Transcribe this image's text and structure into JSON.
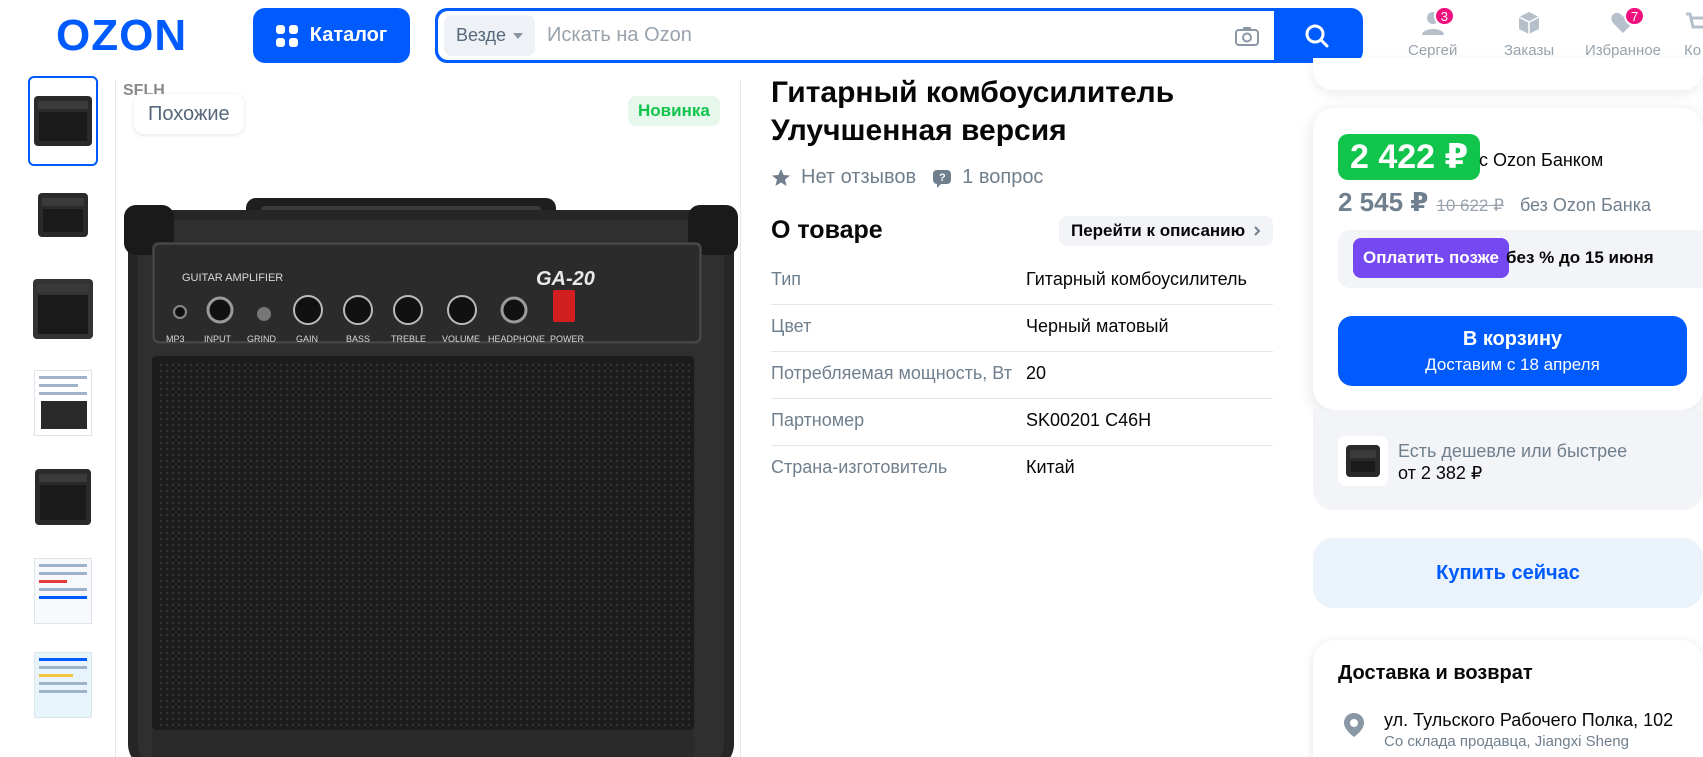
{
  "header": {
    "logo_text": "OZON",
    "catalog_label": "Каталог",
    "search": {
      "scope": "Везде",
      "placeholder": "Искать на Ozon"
    },
    "nav": [
      {
        "label": "Сергей",
        "icon": "user-icon",
        "badge": "3"
      },
      {
        "label": "Заказы",
        "icon": "box-icon",
        "badge": ""
      },
      {
        "label": "Избранное",
        "icon": "heart-icon",
        "badge": "7"
      },
      {
        "label": "Ко",
        "icon": "cart-icon",
        "badge": ""
      }
    ]
  },
  "gallery": {
    "similar_label": "Похожие",
    "new_badge": "Новинка",
    "brand_fragment": "SFLH",
    "amp_texts": {
      "guitar_amplifier": "GUITAR AMPLIFIER",
      "model": "GA-20",
      "controls": [
        "MP3",
        "INPUT",
        "GRIND",
        "GAIN",
        "BASS",
        "TREBLE",
        "VOLUME",
        "HEADPHONE",
        "POWER"
      ]
    },
    "thumbnails": [
      "amp-front",
      "amp-front-2",
      "amp-side",
      "amp-doc",
      "amp-angle",
      "doc-1",
      "doc-2"
    ]
  },
  "product": {
    "title": "Гитарный комбоусилитель Улучшенная версия",
    "reviews": "Нет отзывов",
    "questions": "1 вопрос",
    "about_title": "О товаре",
    "to_description": "Перейти к описанию",
    "specs": [
      {
        "key": "Тип",
        "value": "Гитарный комбоусилитель"
      },
      {
        "key": "Цвет",
        "value": "Черный матовый"
      },
      {
        "key": "Потребляемая мощность, Вт",
        "value": "20"
      },
      {
        "key": "Партномер",
        "value": "SK00201 C46H"
      },
      {
        "key": "Страна-изготовитель",
        "value": "Китай"
      }
    ]
  },
  "pricing": {
    "price_bank": "2 422 ₽",
    "price_bank_label": "с Ozon Банком",
    "price_regular": "2 545 ₽",
    "price_old": "10 622 ₽",
    "price_regular_label": "без Ozon Банка",
    "pay_later_label": "Оплатить позже",
    "pay_later_text": "без % до 15 июня",
    "cart_label": "В корзину",
    "cart_sub": "Доставим с 18 апреля",
    "cheaper_text": "Есть дешевле или быстрее",
    "cheaper_price": "от 2 382 ₽",
    "buy_now_label": "Купить сейчас"
  },
  "delivery": {
    "title": "Доставка и возврат",
    "address": "ул. Тульского Рабочего Полка, 102",
    "seller": "Со склада продавца, Jiangxi Sheng"
  },
  "colors": {
    "brand_blue": "#005bff",
    "price_green": "#10c44c",
    "pay_later_purple": "#7548f2",
    "badge_pink": "#f1117e"
  }
}
